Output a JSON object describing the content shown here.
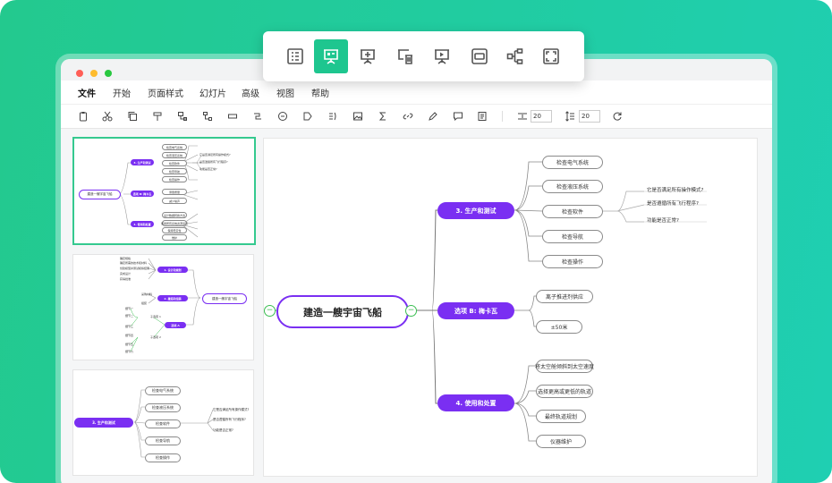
{
  "menu": {
    "items": [
      "文件",
      "开始",
      "页面样式",
      "幻灯片",
      "高级",
      "视图",
      "帮助"
    ]
  },
  "toolbar": {
    "spacing_value": "20",
    "line_height_value": "20"
  },
  "slides": {
    "slide1": {
      "root": "建造一艘宇宙飞船",
      "branches": [
        "3. 生产和测试",
        "选项 B: 梅卡瓦",
        "4. 使用和处置"
      ],
      "leaves_a": [
        "检查电气系统",
        "检查液压系统",
        "检查软件",
        "检查导航",
        "检查操作"
      ],
      "leaves_b": [
        "测量质量",
        "减少噪声"
      ],
      "leaves_c": [
        "设计数据转换方法",
        "使用所有系统资源运行",
        "保持稳定性",
        "维护"
      ],
      "notes": [
        "它是否满足所有操作模式?",
        "是否遵循所有飞行程序?",
        "功能是否正常?"
      ]
    },
    "slide2": {
      "root": "建造一艘宇宙飞船",
      "branches": [
        "1. 设计和规划",
        "2. 建造和组装",
        "选项 A"
      ],
      "leaves_top": [
        "确定规格",
        "确定所需的技术和材料",
        "创建模型并测试模拟结果",
        "完成设计",
        "获得批准"
      ],
      "leaves_mid": [
        "采购材料",
        "组装"
      ],
      "leaves_bot": [
        "子选项 1",
        "子选项 2"
      ],
      "leaves_sub": [
        "细节一",
        "细节二",
        "细节三",
        "细节四",
        "细节五",
        "细节六"
      ]
    },
    "slide3": {
      "branch": "3. 生产和测试",
      "leaves": [
        "检查电气系统",
        "检查液压系统",
        "检查软件",
        "检查导航",
        "检查操作"
      ],
      "notes": [
        "它是否满足所有操作模式?",
        "是否遵循所有飞行程序?",
        "功能是否正常?"
      ]
    }
  },
  "canvas": {
    "root": "建造一艘宇宙飞船",
    "branch_top": "3. 生产和测试",
    "branch_mid": "选项 B: 梅卡瓦",
    "branch_bot": "4. 使用和处置",
    "top_leaves": [
      "检查电气系统",
      "检查液压系统",
      "检查软件",
      "检查导航",
      "检查操作"
    ],
    "notes": [
      "它是否满足所有操作模式?",
      "是否遵循所有飞行程序?",
      "功能是否正常?"
    ],
    "mid_leaves": [
      "离子推进剂供应",
      "±50米"
    ],
    "bot_leaves": [
      "将太空舱倾斜到太空速度",
      "选择更高或更低的轨道",
      "最终轨道规划",
      "仪器维护"
    ]
  },
  "floatbar": {
    "buttons": [
      "outline-icon",
      "presentation-icon",
      "add-slide-icon",
      "delete-slide-icon",
      "play-icon",
      "fit-icon",
      "branch-icon",
      "fullscreen-icon"
    ],
    "active": "presentation-icon"
  },
  "colors": {
    "accent": "#7a2ff2",
    "green": "#1ec68f",
    "bg_gradient_start": "#23c98e",
    "bg_gradient_end": "#1fcfb2"
  }
}
